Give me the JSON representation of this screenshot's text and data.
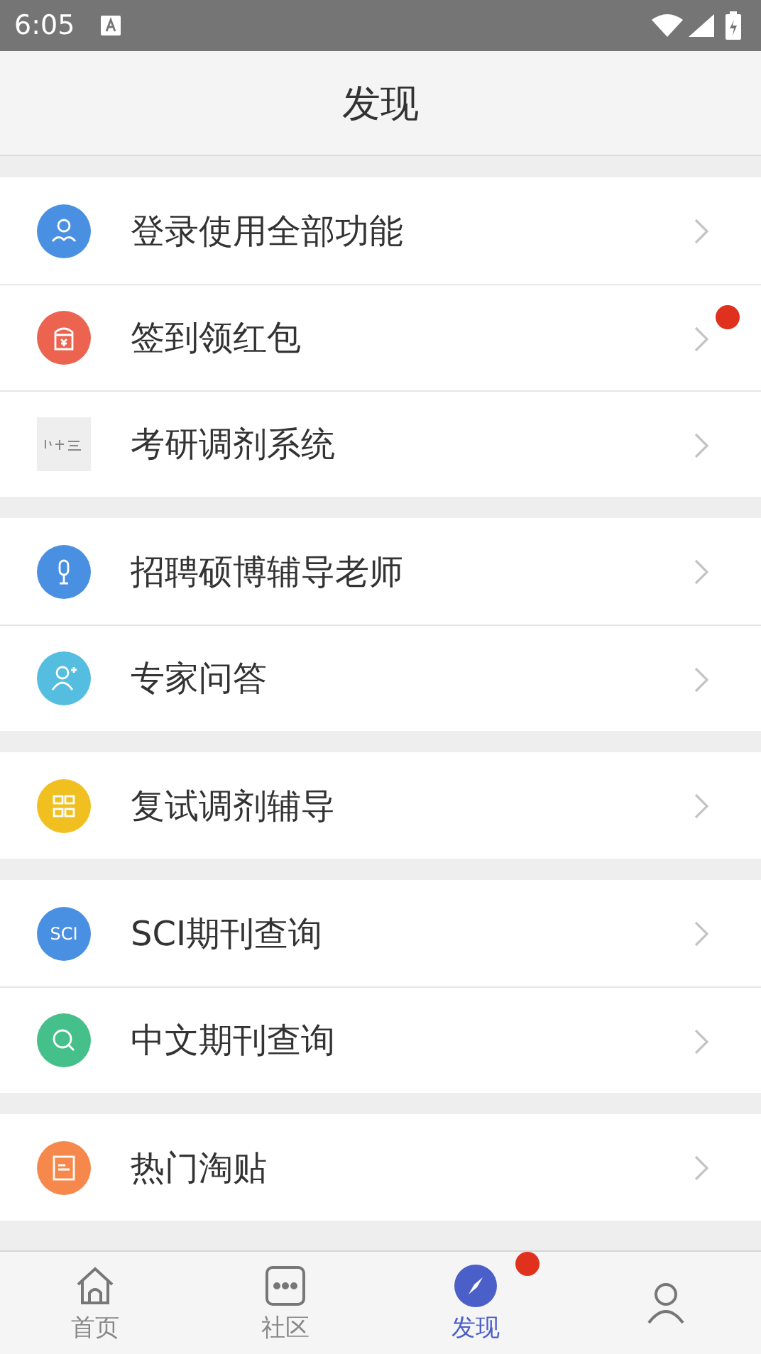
{
  "status_bar": {
    "time": "6:05"
  },
  "header": {
    "title": "发现"
  },
  "groups": [
    {
      "items": [
        {
          "label": "登录使用全部功能",
          "kind": "user",
          "color": "#4a90e2",
          "badge": false
        },
        {
          "label": "签到领红包",
          "kind": "packet",
          "color": "#ec6450",
          "badge": true
        },
        {
          "label": "考研调剂系统",
          "kind": "logo",
          "color": "#eeeeee",
          "badge": false
        }
      ]
    },
    {
      "items": [
        {
          "label": "招聘硕博辅导老师",
          "kind": "microphone",
          "color": "#4a90e2",
          "badge": false
        },
        {
          "label": "专家问答",
          "kind": "adduser",
          "color": "#55bde0",
          "badge": false
        }
      ]
    },
    {
      "items": [
        {
          "label": "复试调剂辅导",
          "kind": "grid",
          "color": "#f0c020",
          "badge": false
        }
      ]
    },
    {
      "items": [
        {
          "label": "SCI期刊查询",
          "kind": "text",
          "icon_text": "SCI",
          "color": "#4a90e2",
          "badge": false
        },
        {
          "label": "中文期刊查询",
          "kind": "search",
          "color": "#45c08a",
          "badge": false
        }
      ]
    },
    {
      "items": [
        {
          "label": "热门淘贴",
          "kind": "document",
          "color": "#f5884a",
          "badge": false
        }
      ]
    }
  ],
  "tabs": [
    {
      "label": "首页",
      "kind": "home",
      "selected": false,
      "badge": false
    },
    {
      "label": "社区",
      "kind": "chat",
      "selected": false,
      "badge": false
    },
    {
      "label": "发现",
      "kind": "compass",
      "selected": true,
      "badge": true
    },
    {
      "kind": "person",
      "selected": false,
      "badge": false
    }
  ]
}
